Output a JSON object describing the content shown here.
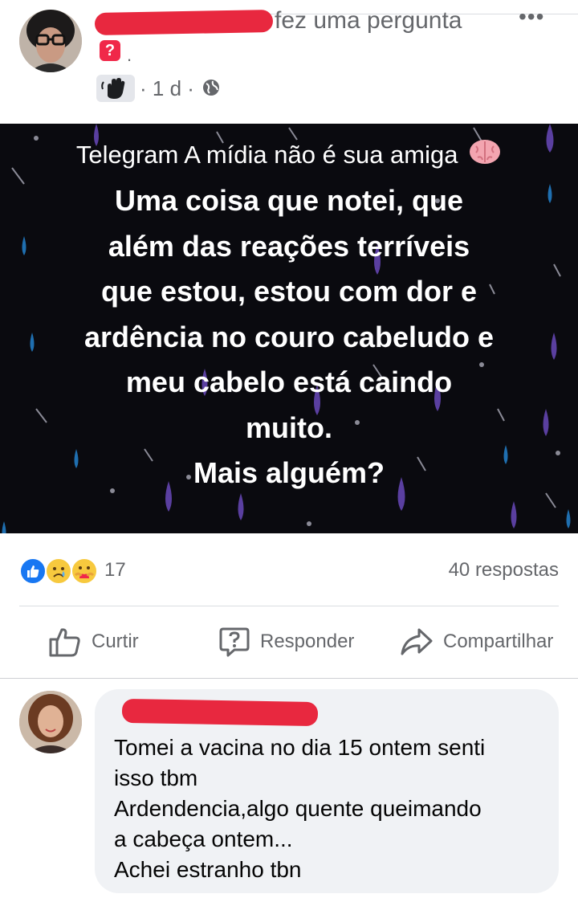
{
  "post": {
    "header_action": "fez uma pergunta",
    "question_badge": "?",
    "after_badge": ".",
    "time_meta": "· 1 d ·",
    "more": "•••"
  },
  "banner": {
    "subtitle": "Telegram A mídia não é sua amiga",
    "lines": [
      "Uma coisa que notei, que",
      "além das reações terríveis",
      "que estou,  estou com dor e",
      "ardência no couro cabeludo e",
      "meu cabelo está caindo",
      "muito.",
      "Mais alguém?"
    ]
  },
  "reactions": {
    "count": "17",
    "responses": "40 respostas"
  },
  "actions": {
    "like": "Curtir",
    "reply": "Responder",
    "share": "Compartilhar"
  },
  "comment": {
    "lines": [
      "Tomei a vacina no dia 15 ontem senti",
      "isso tbm",
      "Ardendencia,algo quente queimando",
      "a cabeça ontem...",
      "Achei estranho tbn"
    ]
  },
  "colors": {
    "secondary_text": "#65676b",
    "banner_bg": "#0a0a0f",
    "like_blue": "#1877f2",
    "redaction_red": "#e8283f",
    "bubble_bg": "#f0f2f5"
  },
  "icons": [
    "more-icon",
    "question-icon",
    "wave-icon",
    "globe-icon",
    "brain-icon",
    "like-reaction-icon",
    "sad-reaction-icon",
    "care-reaction-icon",
    "thumbs-up-icon",
    "question-bubble-icon",
    "share-arrow-icon"
  ]
}
